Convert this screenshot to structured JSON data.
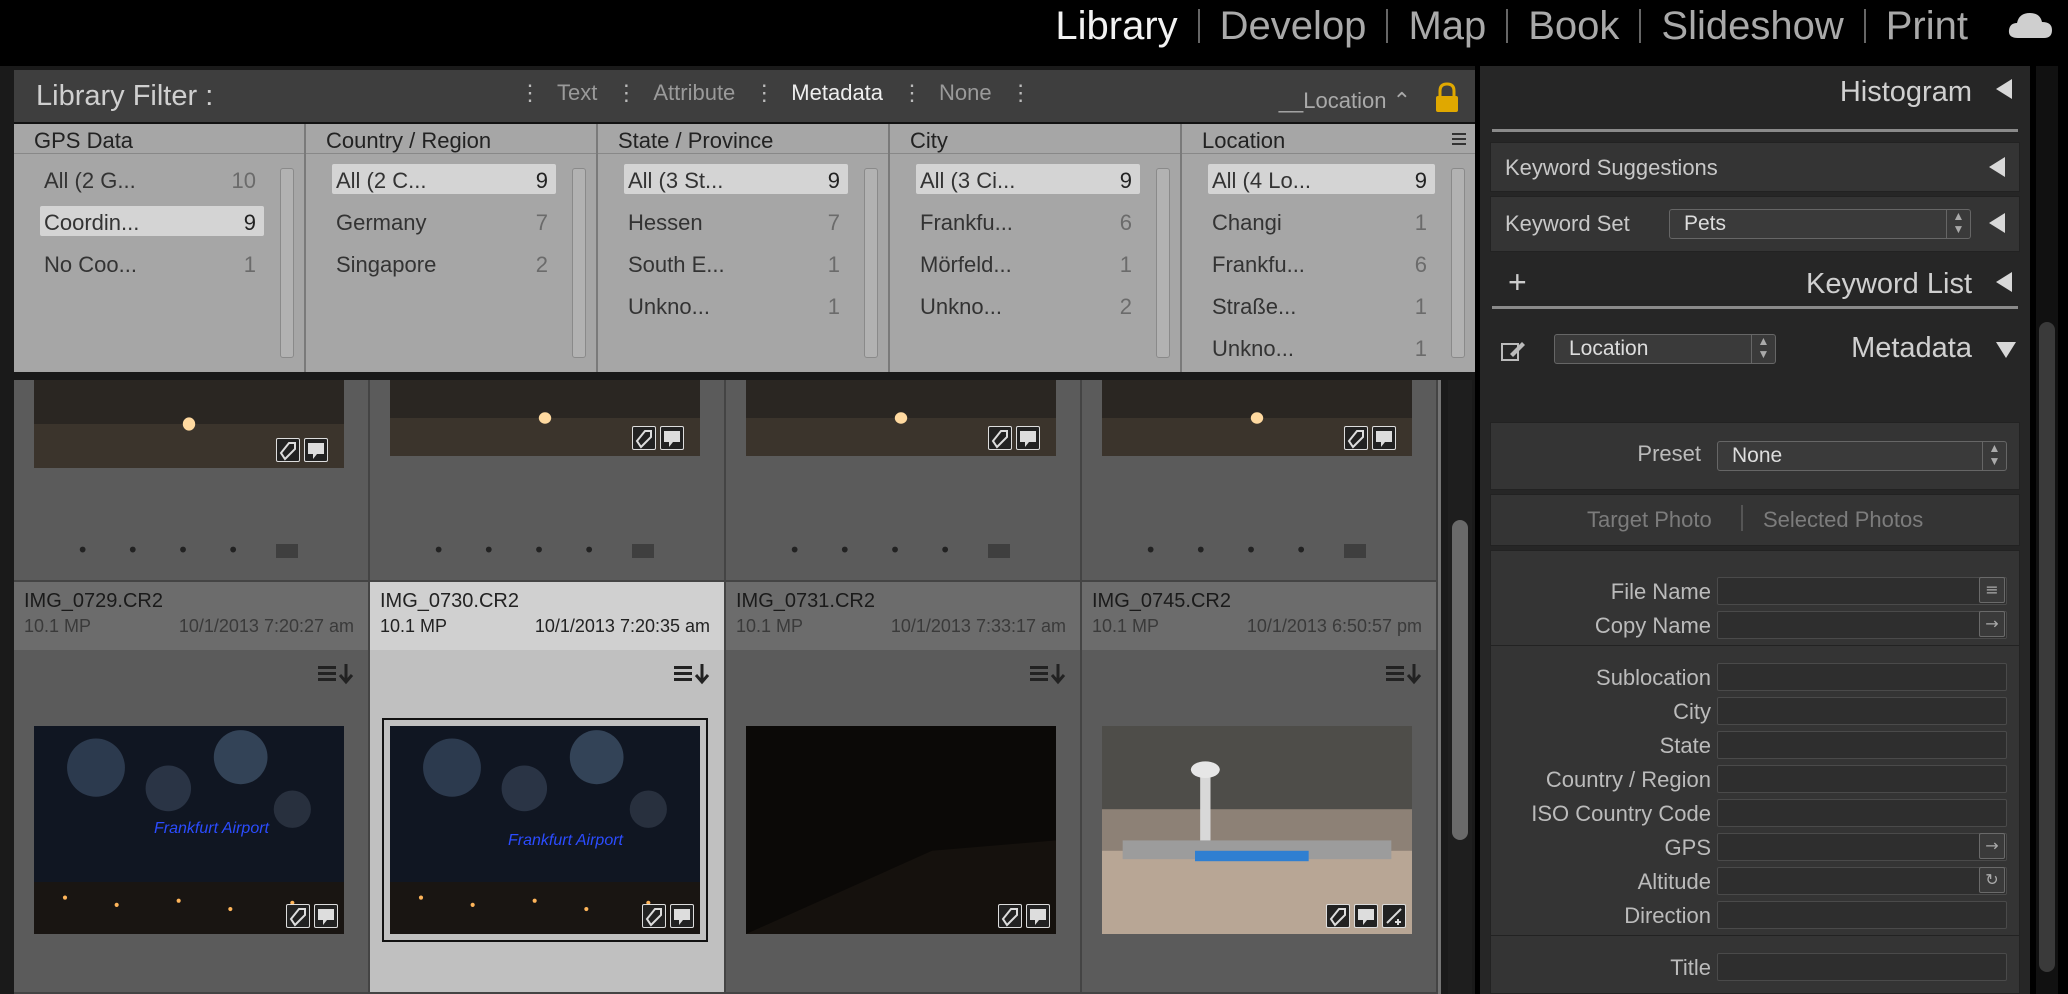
{
  "modules": {
    "library": "Library",
    "develop": "Develop",
    "map": "Map",
    "book": "Book",
    "slideshow": "Slideshow",
    "print": "Print"
  },
  "filter": {
    "title": "Library Filter :",
    "tabs": [
      "Text",
      "Attribute",
      "Metadata",
      "None"
    ],
    "active_tab": "Metadata",
    "preset": "__Location"
  },
  "columns": [
    {
      "header": "GPS Data",
      "rows": [
        {
          "name": "All (2 G...",
          "count": "10"
        },
        {
          "name": "Coordin...",
          "count": "9",
          "selected": true
        },
        {
          "name": "No Coo...",
          "count": "1"
        }
      ]
    },
    {
      "header": "Country / Region",
      "rows": [
        {
          "name": "All (2 C...",
          "count": "9",
          "selected": true
        },
        {
          "name": "Germany",
          "count": "7"
        },
        {
          "name": "Singapore",
          "count": "2"
        }
      ]
    },
    {
      "header": "State / Province",
      "rows": [
        {
          "name": "All (3 St...",
          "count": "9",
          "selected": true
        },
        {
          "name": "Hessen",
          "count": "7"
        },
        {
          "name": "South E...",
          "count": "1"
        },
        {
          "name": "Unkno...",
          "count": "1"
        }
      ]
    },
    {
      "header": "City",
      "rows": [
        {
          "name": "All (3 Ci...",
          "count": "9",
          "selected": true
        },
        {
          "name": "Frankfu...",
          "count": "6"
        },
        {
          "name": "Mörfeld...",
          "count": "1"
        },
        {
          "name": "Unkno...",
          "count": "2"
        }
      ]
    },
    {
      "header": "Location",
      "rows": [
        {
          "name": "All (4 Lo...",
          "count": "9",
          "selected": true
        },
        {
          "name": "Changi",
          "count": "1"
        },
        {
          "name": "Frankfu...",
          "count": "6"
        },
        {
          "name": "Straße...",
          "count": "1"
        },
        {
          "name": "Unkno...",
          "count": "1"
        }
      ]
    }
  ],
  "photos": [
    {
      "file": "IMG_0729.CR2",
      "mp": "10.1 MP",
      "date": "10/1/2013 7:20:27 am"
    },
    {
      "file": "IMG_0730.CR2",
      "mp": "10.1 MP",
      "date": "10/1/2013 7:20:35 am"
    },
    {
      "file": "IMG_0731.CR2",
      "mp": "10.1 MP",
      "date": "10/1/2013 7:33:17 am"
    },
    {
      "file": "IMG_0745.CR2",
      "mp": "10.1 MP",
      "date": "10/1/2013 6:50:57 pm"
    }
  ],
  "thumb_texts": {
    "airport_sign": "Frankfurt Airport"
  },
  "rating_dots": "• • • • •",
  "right_panel": {
    "histogram": "Histogram",
    "keyword_suggestions": "Keyword Suggestions",
    "keyword_set_label": "Keyword Set",
    "keyword_set_value": "Pets",
    "keyword_list": "Keyword List",
    "keyword_list_add": "+",
    "metadata": "Metadata",
    "metadata_view": "Location",
    "preset_label": "Preset",
    "preset_value": "None",
    "target_photo": "Target Photo",
    "selected_photos": "Selected Photos",
    "fields": [
      "File Name",
      "Copy Name",
      "Sublocation",
      "City",
      "State",
      "Country / Region",
      "ISO Country Code",
      "GPS",
      "Altitude",
      "Direction",
      "Title"
    ]
  },
  "colors": {
    "accent": "#d8d8d8",
    "panel": "#262626",
    "filter_bg": "#a6a6a6"
  }
}
